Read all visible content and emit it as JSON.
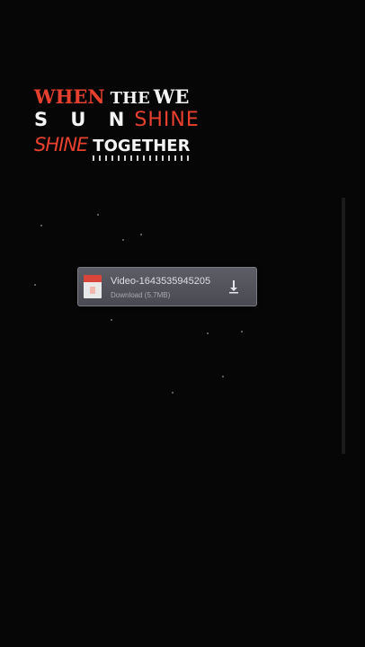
{
  "overlay_text": {
    "line1": {
      "word1": "WHEN",
      "word2": "THE",
      "word3": "WE"
    },
    "line2": {
      "word1": "S U N",
      "word2": "SHINE"
    },
    "line3": {
      "word1": "SHINE",
      "word2": "TOGETHER"
    }
  },
  "download": {
    "file_name": "Video-1643535945205",
    "status": "Download (5.7MB)",
    "icon": "download-arrow-icon",
    "file_icon": "video-file-icon"
  },
  "colors": {
    "accent_red": "#e8402e",
    "text_white": "#f4f4f4",
    "card_bg": "#55555d",
    "background": "#060606"
  }
}
